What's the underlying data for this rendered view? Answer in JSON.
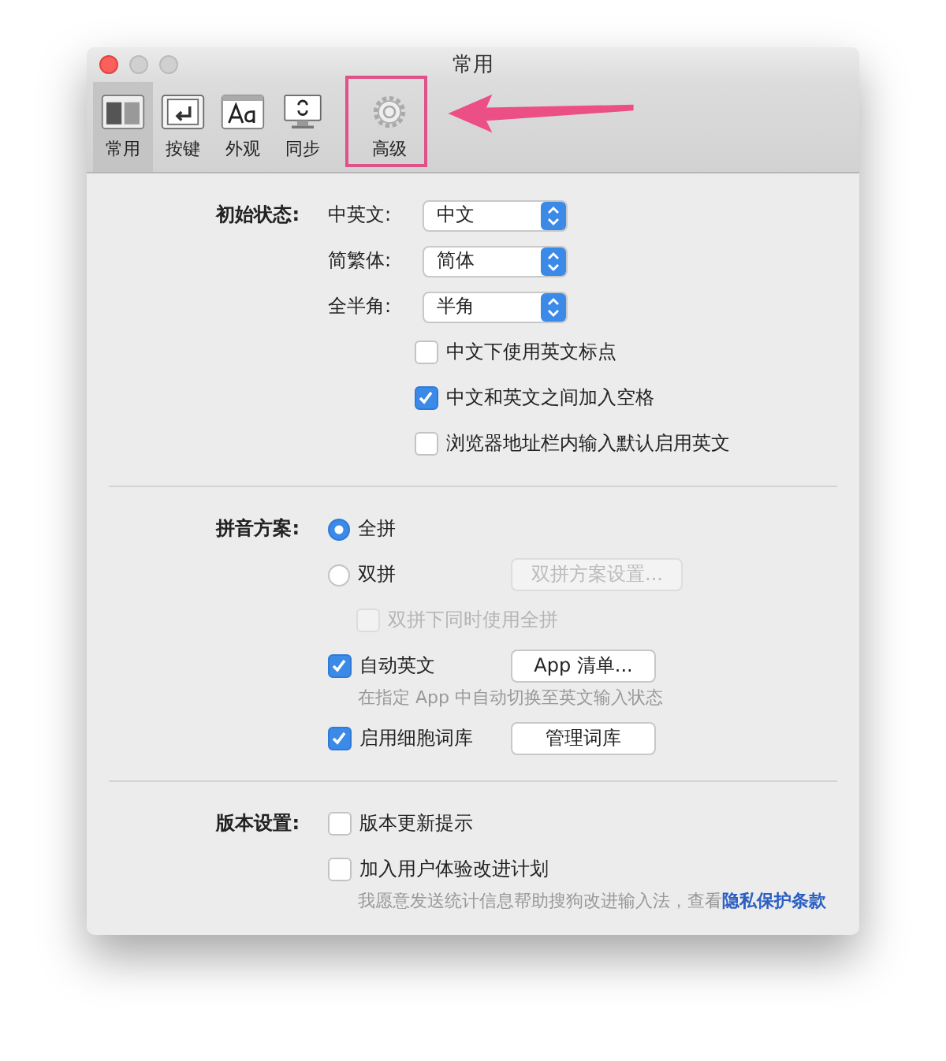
{
  "window": {
    "title": "常用"
  },
  "tabs": [
    {
      "label": "常用",
      "selected": true,
      "highlighted": false
    },
    {
      "label": "按键",
      "selected": false,
      "highlighted": false
    },
    {
      "label": "外观",
      "selected": false,
      "highlighted": false
    },
    {
      "label": "同步",
      "selected": false,
      "highlighted": false
    },
    {
      "label": "高级",
      "selected": false,
      "highlighted": true
    }
  ],
  "sections": [
    {
      "label": "初始状态:",
      "rows": [
        {
          "kind": "popup",
          "label": "中英文:",
          "value": "中文"
        },
        {
          "kind": "popup",
          "label": "简繁体:",
          "value": "简体"
        },
        {
          "kind": "popup",
          "label": "全半角:",
          "value": "半角"
        },
        {
          "kind": "checkbox",
          "label": "中文下使用英文标点",
          "checked": false,
          "disabled": false
        },
        {
          "kind": "checkbox",
          "label": "中文和英文之间加入空格",
          "checked": true,
          "disabled": false
        },
        {
          "kind": "checkbox",
          "label": "浏览器地址栏内输入默认启用英文",
          "checked": false,
          "disabled": false
        }
      ]
    },
    {
      "label": "拼音方案:",
      "rows": [
        {
          "kind": "radio",
          "label": "全拼",
          "selected": true
        },
        {
          "kind": "radio",
          "label": "双拼",
          "selected": false,
          "button": {
            "label": "双拼方案设置...",
            "disabled": true
          },
          "children": [
            {
              "kind": "checkbox",
              "label": "双拼下同时使用全拼",
              "checked": false,
              "disabled": true
            }
          ]
        },
        {
          "kind": "checkbox",
          "label": "自动英文",
          "checked": true,
          "disabled": false,
          "button": {
            "label": "App 清单...",
            "disabled": false
          },
          "note": "在指定 App 中自动切换至英文输入状态"
        },
        {
          "kind": "checkbox",
          "label": "启用细胞词库",
          "checked": true,
          "disabled": false,
          "button": {
            "label": "管理词库",
            "disabled": false
          }
        }
      ]
    },
    {
      "label": "版本设置:",
      "rows": [
        {
          "kind": "checkbox",
          "label": "版本更新提示",
          "checked": false,
          "disabled": false
        },
        {
          "kind": "checkbox",
          "label": "加入用户体验改进计划",
          "checked": false,
          "disabled": false,
          "note": "我愿意发送统计信息帮助搜狗改进输入法，查看",
          "link": "隐私保护条款"
        }
      ]
    }
  ]
}
